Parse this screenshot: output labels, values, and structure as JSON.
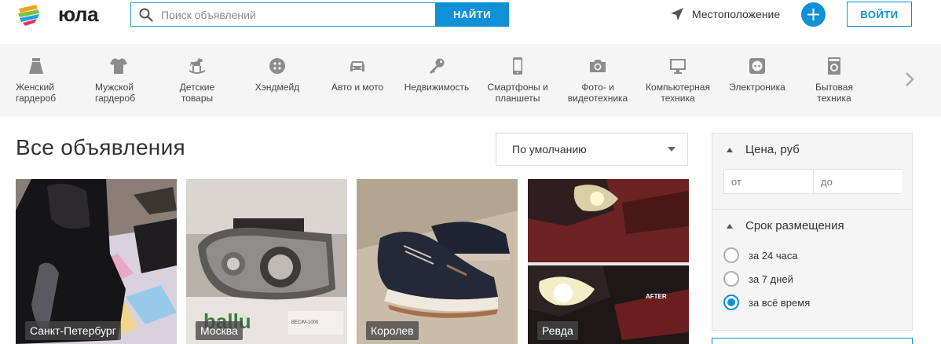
{
  "header": {
    "logo_text": "юла",
    "search": {
      "placeholder": "Поиск объявлений",
      "value": ""
    },
    "search_button": "НАЙТИ",
    "location": "Местоположение",
    "add_icon": "plus-icon",
    "login_button": "ВОЙТИ",
    "accent_color": "#0f90d7"
  },
  "categories": [
    {
      "icon": "skirt-icon",
      "label": "Женский гардероб"
    },
    {
      "icon": "tshirt-icon",
      "label": "Мужской гардероб"
    },
    {
      "icon": "rocking-horse-icon",
      "label": "Детские товары"
    },
    {
      "icon": "button-icon",
      "label": "Хэндмейд"
    },
    {
      "icon": "car-icon",
      "label": "Авто и мото"
    },
    {
      "icon": "key-icon",
      "label": "Недвижимость"
    },
    {
      "icon": "smartphone-icon",
      "label": "Смартфоны и планшеты"
    },
    {
      "icon": "camera-icon",
      "label": "Фото- и видеотехника"
    },
    {
      "icon": "monitor-icon",
      "label": "Компьютерная техника"
    },
    {
      "icon": "socket-icon",
      "label": "Электроника"
    },
    {
      "icon": "washing-machine-icon",
      "label": "Бытовая техника"
    }
  ],
  "main": {
    "title": "Все объявления",
    "sort": {
      "selected": "По умолчанию"
    },
    "listings": [
      {
        "city": "Санкт-Петербург",
        "photo": "black leather shoe"
      },
      {
        "city": "Москва",
        "photo": "car headlight"
      },
      {
        "city": "Королев",
        "photo": "navy sneaker"
      },
      {
        "city": "Ревда",
        "photo": "car headlights"
      }
    ]
  },
  "filters": {
    "price": {
      "title": "Цена, руб",
      "from_placeholder": "от",
      "to_placeholder": "до"
    },
    "period": {
      "title": "Срок размещения",
      "options": [
        {
          "label": "за 24 часа",
          "checked": false
        },
        {
          "label": "за 7 дней",
          "checked": false
        },
        {
          "label": "за всё время",
          "checked": true
        }
      ]
    }
  },
  "photo_text": {
    "card2_box": "ballu",
    "card2_box_small": "ВЕС/М-1000",
    "card4_after": "AFTER"
  }
}
